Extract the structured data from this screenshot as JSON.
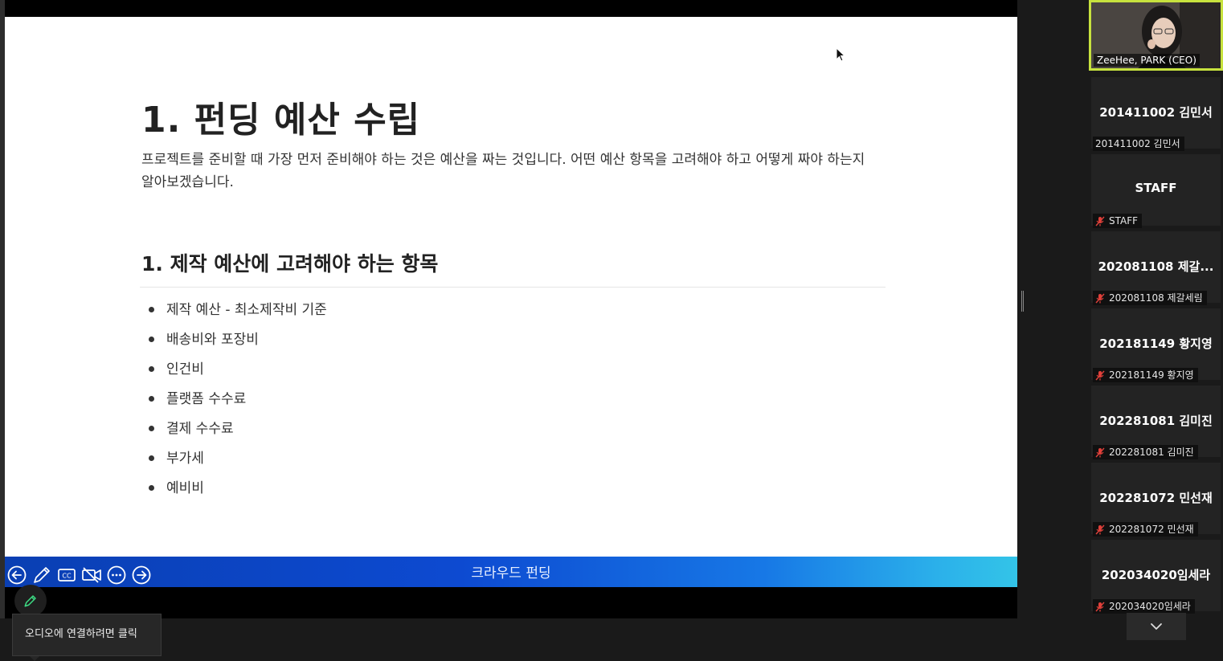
{
  "slide": {
    "title": "1. 펀딩 예산 수립",
    "intro": "프로젝트를 준비할 때 가장 먼저 준비해야 하는 것은 예산을 짜는 것입니다. 어떤 예산 항목을 고려해야 하고 어떻게 짜야 하는지 알아보겠습니다.",
    "subheading": "1. 제작 예산에 고려해야 하는 항목",
    "items": [
      "제작 예산 - 최소제작비 기준",
      "배송비와 포장비",
      "인건비",
      "플랫폼 수수료",
      "결제 수수료",
      "부가세",
      "예비비"
    ],
    "footer": "크라우드 펀딩"
  },
  "presentation_controls": [
    "previous-slide-icon",
    "pen-icon",
    "closed-caption-icon",
    "video-off-icon",
    "more-icon",
    "next-slide-icon"
  ],
  "audio_tooltip": "오디오에 연결하려면 클릭",
  "self_video": {
    "name": "ZeeHee, PARK (CEO)"
  },
  "participants": [
    {
      "tile_name": "201411002 김민서",
      "label": "201411002 김민서",
      "muted": false
    },
    {
      "tile_name": "STAFF",
      "label": "STAFF",
      "muted": true
    },
    {
      "tile_name": "202081108 제갈...",
      "label": "202081108 제갈세림",
      "muted": true
    },
    {
      "tile_name": "202181149 황지영",
      "label": "202181149 황지영",
      "muted": true
    },
    {
      "tile_name": "202281081 김미진",
      "label": "202281081 김미진",
      "muted": true
    },
    {
      "tile_name": "202281072 민선재",
      "label": "202281072 민선재",
      "muted": true
    },
    {
      "tile_name": "202034020임세라",
      "label": "202034020임세라",
      "muted": true
    }
  ],
  "colors": {
    "active_speaker_border": "#c7e23e",
    "muted_mic": "#e0403a",
    "slide_bar_start": "#0a3fb3",
    "slide_bar_end": "#33c4e8"
  }
}
